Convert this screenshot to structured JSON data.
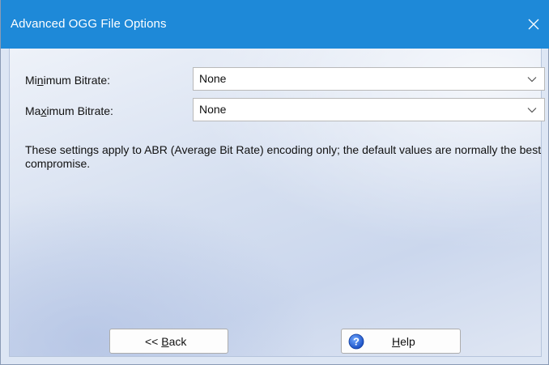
{
  "window": {
    "title": "Advanced OGG File Options",
    "colors": {
      "titlebar": "#1e89d8",
      "accent": "#1e89d8"
    }
  },
  "form": {
    "min_bitrate": {
      "label_pre": "Mi",
      "label_ul": "n",
      "label_post": "imum Bitrate:",
      "value": "None"
    },
    "max_bitrate": {
      "label_pre": "Ma",
      "label_ul": "x",
      "label_post": "imum Bitrate:",
      "value": "None"
    }
  },
  "description": "These settings apply to ABR (Average Bit Rate) encoding only; the default values are normally the best compromise.",
  "buttons": {
    "back": {
      "label_pre": "<< ",
      "label_ul": "B",
      "label_post": "ack"
    },
    "help": {
      "label_ul": "H",
      "label_post": "elp",
      "icon": "help-icon"
    }
  }
}
